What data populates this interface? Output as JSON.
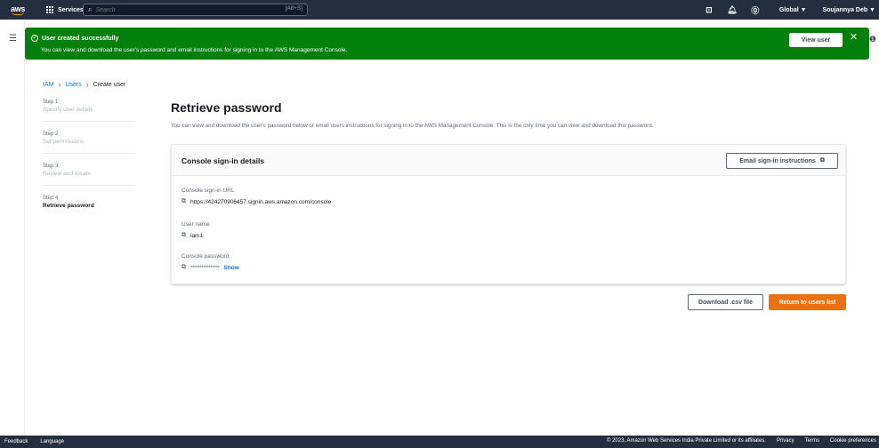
{
  "topnav": {
    "logo": "aws",
    "services_label": "Services",
    "search_placeholder": "Search",
    "search_shortcut": "[Alt+S]",
    "region": "Global ▼",
    "user": "Soujannya Deb ▼",
    "icons": [
      "cloudshell-icon",
      "bell-icon",
      "help-icon"
    ]
  },
  "flash": {
    "title": "User created successfully",
    "message": "You can view and download the user's password and email instructions for signing in to the AWS Management Console.",
    "button": "View user",
    "color": "#037f0c"
  },
  "breadcrumb": {
    "items": [
      "IAM",
      "Users",
      "Create user"
    ]
  },
  "steps": [
    {
      "num": "Step 1",
      "label": "Specify user details"
    },
    {
      "num": "Step 2",
      "label": "Set permissions"
    },
    {
      "num": "Step 3",
      "label": "Review and create"
    },
    {
      "num": "Step 4",
      "label": "Retrieve password"
    }
  ],
  "main": {
    "title": "Retrieve password",
    "description": "You can view and download the user's password below or email users instructions for signing in to the AWS Management Console. This is the only time you can view and download this password.",
    "card": {
      "title": "Console sign-in details",
      "email_button": "Email sign-in instructions",
      "fields": [
        {
          "label": "Console sign-in URL",
          "value": "https://424270906457.signin.aws.amazon.com/console"
        },
        {
          "label": "User name",
          "value": "iam1"
        },
        {
          "label": "Console password",
          "value": "****************",
          "action": "Show"
        }
      ]
    },
    "actions": {
      "download": "Download .csv file",
      "return": "Return to users list",
      "primary_color": "#ec7211"
    }
  },
  "footer": {
    "left": [
      "Feedback",
      "Language"
    ],
    "copyright": "© 2023, Amazon Web Services India Private Limited or its affiliates.",
    "links": [
      "Privacy",
      "Terms",
      "Cookie preferences"
    ]
  }
}
